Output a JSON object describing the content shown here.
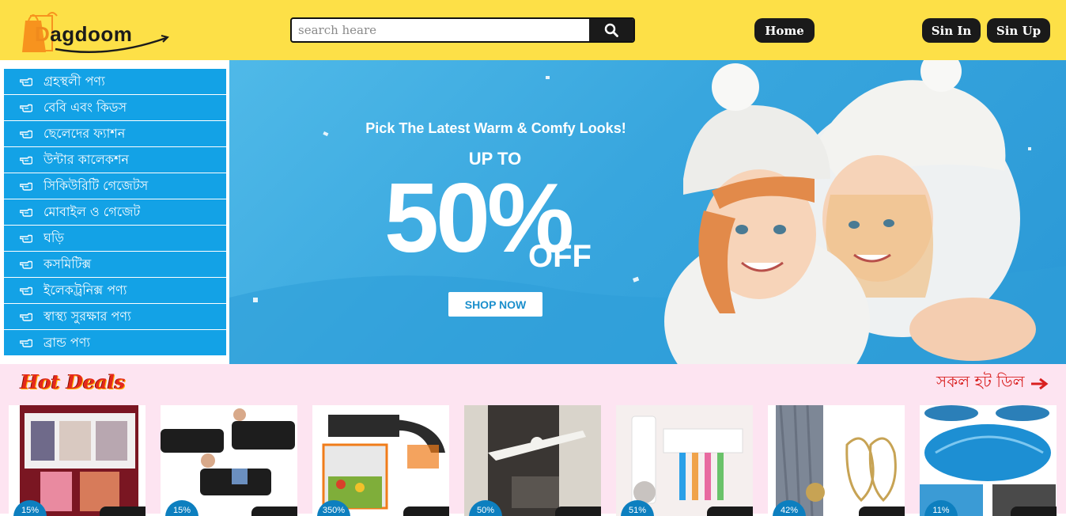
{
  "header": {
    "logo": "Dagdoom",
    "search_placeholder": "search heare",
    "home": "Home",
    "sign_in": "Sin In",
    "sign_up": "Sin Up"
  },
  "categories": [
    "গ্রহস্থলী পণ্য",
    "বেবি এবং কিডস",
    "ছেলেদের ফ্যাশন",
    "উন্টার কালেকশন",
    "সিকিউরিটি গেজেটস",
    "মোবাইল ও গেজেট",
    "ঘড়ি",
    "কসমিটিক্স",
    "ইলেকট্রনিক্স পণ্য",
    "স্বাস্থ্য সুরক্ষার পণ্য",
    "ব্রান্ড পণ্য"
  ],
  "banner": {
    "headline": "Pick The Latest Warm & Comfy Looks!",
    "upto": "UP TO",
    "percent": "50%",
    "off": "OFF",
    "cta": "SHOP NOW"
  },
  "hot_deals": {
    "title": "Hot Deals",
    "see_all": "সকল হট ডিল",
    "items": [
      {
        "discount": "15%"
      },
      {
        "discount": "15%"
      },
      {
        "discount": "350%"
      },
      {
        "discount": "50%"
      },
      {
        "discount": "51%"
      },
      {
        "discount": "42%"
      },
      {
        "discount": "11%"
      }
    ]
  },
  "colors": {
    "header_bg": "#fde047",
    "category_bg": "#13a2e6",
    "deals_bg": "#fde4f1",
    "badge": "#0d7fbf",
    "see_all": "#d92020"
  }
}
